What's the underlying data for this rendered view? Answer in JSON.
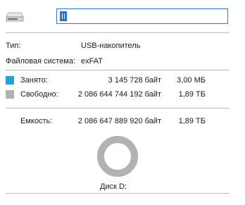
{
  "header": {
    "drive_icon": "usb-drive-icon",
    "name_value": ""
  },
  "info": {
    "type_label": "Тип:",
    "type_value": "USB-накопитель",
    "fs_label": "Файловая система:",
    "fs_value": "exFAT"
  },
  "usage": {
    "used_label": "Занято:",
    "used_bytes": "3 145 728 байт",
    "used_size": "3,00 МБ",
    "used_color": "#26a0da",
    "free_label": "Свободно:",
    "free_bytes": "2 086 644 744 192 байт",
    "free_size": "1,89 ТБ",
    "free_color": "#b2b2b2",
    "capacity_label": "Емкость:",
    "capacity_bytes": "2 086 647 889 920 байт",
    "capacity_size": "1,89 ТБ",
    "used_fraction": 1.5e-06
  },
  "disk": {
    "label": "Диск D:"
  }
}
